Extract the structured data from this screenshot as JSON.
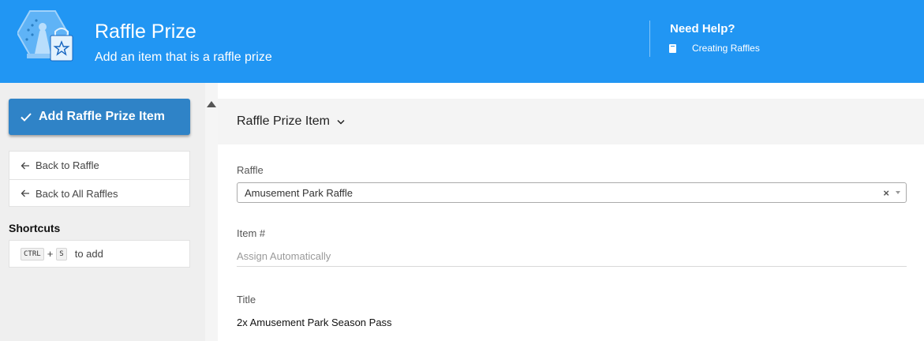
{
  "header": {
    "title": "Raffle Prize",
    "subtitle": "Add an item that is a raffle prize",
    "logo_icon": "raffle-prize-logo-icon",
    "background_color": "#2196f3",
    "help": {
      "title": "Need Help?",
      "link_label": "Creating Raffles",
      "link_icon": "book-icon"
    }
  },
  "sidebar": {
    "primary_action": {
      "label": "Add Raffle Prize Item",
      "icon": "check-icon",
      "color": "#2f83c7"
    },
    "nav": [
      {
        "label": "Back to Raffle",
        "icon": "arrow-left-icon"
      },
      {
        "label": "Back to All Raffles",
        "icon": "arrow-left-icon"
      }
    ],
    "shortcuts": {
      "title": "Shortcuts",
      "keys": [
        "CTRL",
        "S"
      ],
      "separator": "+",
      "description": "to add"
    }
  },
  "main": {
    "section_title": "Raffle Prize Item",
    "fields": {
      "raffle": {
        "label": "Raffle",
        "value": "Amusement Park Raffle",
        "clear_symbol": "×"
      },
      "item_number": {
        "label": "Item #",
        "placeholder": "Assign Automatically",
        "value": ""
      },
      "title": {
        "label": "Title",
        "value": "2x Amusement Park Season Pass"
      }
    }
  }
}
